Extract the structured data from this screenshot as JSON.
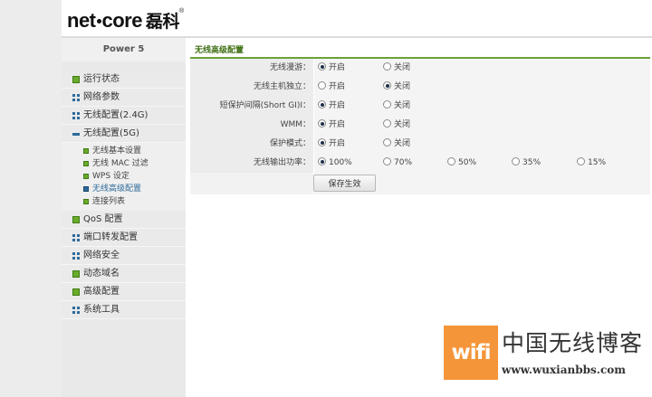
{
  "brand": {
    "name_left": "net",
    "name_right": "core",
    "name_cn": "磊科",
    "reg_mark": "®"
  },
  "sidebar": {
    "model": "Power 5",
    "items": [
      {
        "label": "运行状态",
        "icon": "green-square-icon"
      },
      {
        "label": "网络参数",
        "icon": "grid-icon"
      },
      {
        "label": "无线配置(2.4G)",
        "icon": "grid-icon"
      },
      {
        "label": "无线配置(5G)",
        "icon": "minus-icon"
      }
    ],
    "submenu": [
      {
        "label": "无线基本设置",
        "active": false
      },
      {
        "label": "无线 MAC 过滤",
        "active": false
      },
      {
        "label": "WPS 设定",
        "active": false
      },
      {
        "label": "无线高级配置",
        "active": true
      },
      {
        "label": "连接列表",
        "active": false
      }
    ],
    "items_after": [
      {
        "label": "QoS 配置",
        "icon": "green-square-icon"
      },
      {
        "label": "端口转发配置",
        "icon": "grid-icon"
      },
      {
        "label": "网络安全",
        "icon": "grid-icon"
      },
      {
        "label": "动态域名",
        "icon": "green-square-icon"
      },
      {
        "label": "高级配置",
        "icon": "green-square-icon"
      },
      {
        "label": "系统工具",
        "icon": "grid-icon"
      }
    ]
  },
  "section": {
    "title": "无线高级配置"
  },
  "form": {
    "option_on": "开启",
    "option_off": "关闭",
    "rows": [
      {
        "label": "无线漫游：",
        "selected": "on"
      },
      {
        "label": "无线主机独立：",
        "selected": "off"
      },
      {
        "label": "短保护间隔(Short GI)I：",
        "selected": "on"
      },
      {
        "label": "WMM：",
        "selected": "on"
      },
      {
        "label": "保护模式：",
        "selected": "on"
      }
    ],
    "power": {
      "label": "无线输出功率：",
      "options": [
        "100%",
        "70%",
        "50%",
        "35%",
        "15%"
      ],
      "selected": "100%"
    },
    "save_label": "保存生效"
  },
  "watermark": {
    "tag": "wifi",
    "title": "中国无线博客",
    "url": "www.wuxianbbs.com"
  },
  "colors": {
    "accent_green": "#6aa23a",
    "title_green": "#3d6e12",
    "icon_blue": "#2d6a9a",
    "watermark_orange": "#f5953a"
  }
}
